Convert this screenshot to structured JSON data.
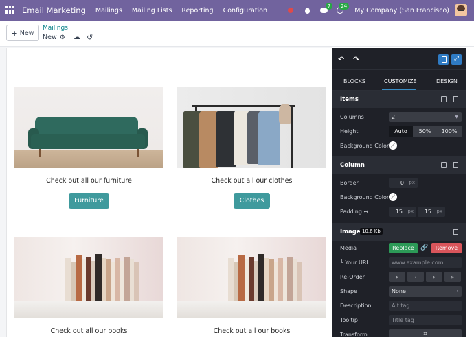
{
  "navbar": {
    "brand": "Email Marketing",
    "menu": [
      "Mailings",
      "Mailing Lists",
      "Reporting",
      "Configuration"
    ],
    "messages_count": "7",
    "activities_count": "24",
    "company": "My Company (San Francisco)"
  },
  "control": {
    "new_label": "New",
    "breadcrumb_parent": "Mailings",
    "breadcrumb_current": "New"
  },
  "content": {
    "cards": [
      {
        "caption": "Check out all our furniture",
        "button": "Furniture"
      },
      {
        "caption": "Check out all our clothes",
        "button": "Clothes"
      },
      {
        "caption": "Check out all our books",
        "button": ""
      },
      {
        "caption": "Check out all our books",
        "button": ""
      }
    ]
  },
  "panel": {
    "tabs": [
      "BLOCKS",
      "CUSTOMIZE",
      "DESIGN"
    ],
    "active_tab": "CUSTOMIZE",
    "items": {
      "title": "Items",
      "columns_label": "Columns",
      "columns_value": "2",
      "height_label": "Height",
      "height_options": [
        "Auto",
        "50%",
        "100%"
      ],
      "bg_label": "Background Color"
    },
    "column": {
      "title": "Column",
      "border_label": "Border",
      "border_value": "0",
      "bg_label": "Background Color",
      "padding_label": "Padding ↔",
      "padding_left": "15",
      "padding_right": "15",
      "unit": "px"
    },
    "image": {
      "title": "Image",
      "size": "10.6 Kb",
      "media_label": "Media",
      "replace": "Replace",
      "remove": "Remove",
      "url_label": "└ Your URL",
      "url_placeholder": "www.example.com",
      "reorder_label": "Re-Order",
      "reorder_buttons": [
        "«",
        "‹",
        "›",
        "»"
      ],
      "shape_label": "Shape",
      "shape_value": "None",
      "description_label": "Description",
      "description_placeholder": "Alt tag",
      "tooltip_label": "Tooltip",
      "tooltip_placeholder": "Title tag",
      "transform_label": "Transform"
    }
  },
  "colors": {
    "navbar": "#71639e",
    "cta": "#3f9a9d",
    "panel_bg": "#1f2128",
    "replace": "#2c9a57",
    "remove": "#d9555b",
    "accent": "#2f7bc4"
  }
}
